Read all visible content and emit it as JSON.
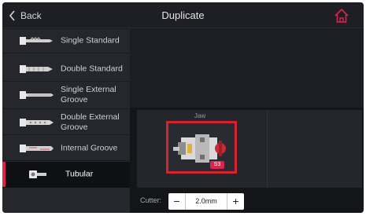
{
  "header": {
    "back_label": "Back",
    "title": "Duplicate",
    "home_icon": "home-icon"
  },
  "sidebar": {
    "items": [
      {
        "label": "Single Standard",
        "icon": "single-standard-key-icon",
        "active": false
      },
      {
        "label": "Double Standard",
        "icon": "double-standard-key-icon",
        "active": false
      },
      {
        "label": "Single External Groove",
        "icon": "single-external-groove-key-icon",
        "active": false
      },
      {
        "label": "Double External Groove",
        "icon": "double-external-groove-key-icon",
        "active": false
      },
      {
        "label": "Internal Groove",
        "icon": "internal-groove-key-icon",
        "active": false
      },
      {
        "label": "Tubular",
        "icon": "tubular-key-icon",
        "active": true
      }
    ]
  },
  "jaw": {
    "label": "Jaw",
    "badge": "S3"
  },
  "cutter": {
    "label": "Cutter:",
    "minus": "−",
    "value": "2.0mm",
    "plus": "+"
  },
  "colors": {
    "accent": "#e0234b",
    "selection_border": "#d2232f",
    "background": "#1c1d22",
    "sidebar_bg": "#26272d"
  }
}
